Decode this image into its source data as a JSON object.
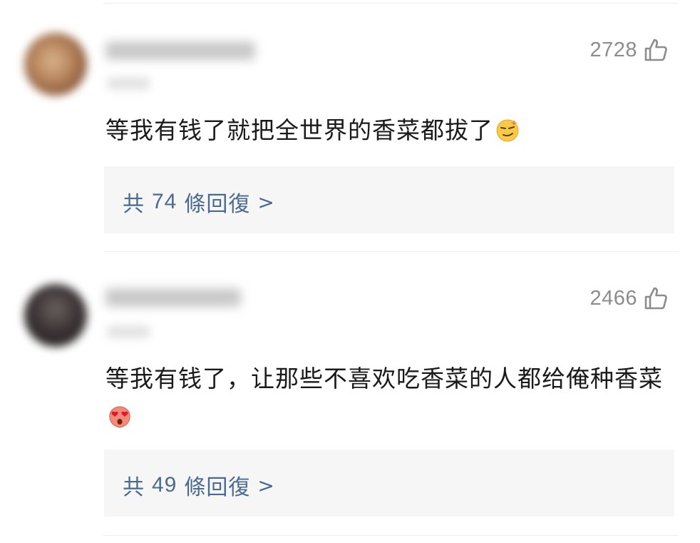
{
  "comments": [
    {
      "likes": "2728",
      "text": "等我有钱了就把全世界的香菜都拔了",
      "emoji": "smirk-face-emoji",
      "replies": {
        "prefix": "共",
        "count": "74",
        "suffix": "條回復",
        "chevron": ">"
      }
    },
    {
      "likes": "2466",
      "text": "等我有钱了，让那些不喜欢吃香菜的人都给俺种香菜",
      "emoji": "heart-eyes-emoji",
      "replies": {
        "prefix": "共",
        "count": "49",
        "suffix": "條回復",
        "chevron": ">"
      }
    }
  ],
  "colors": {
    "link": "#4a6a8f",
    "muted": "#8c8c8c",
    "text": "#1a1a1a",
    "reply_bg": "#f6f6f6"
  }
}
